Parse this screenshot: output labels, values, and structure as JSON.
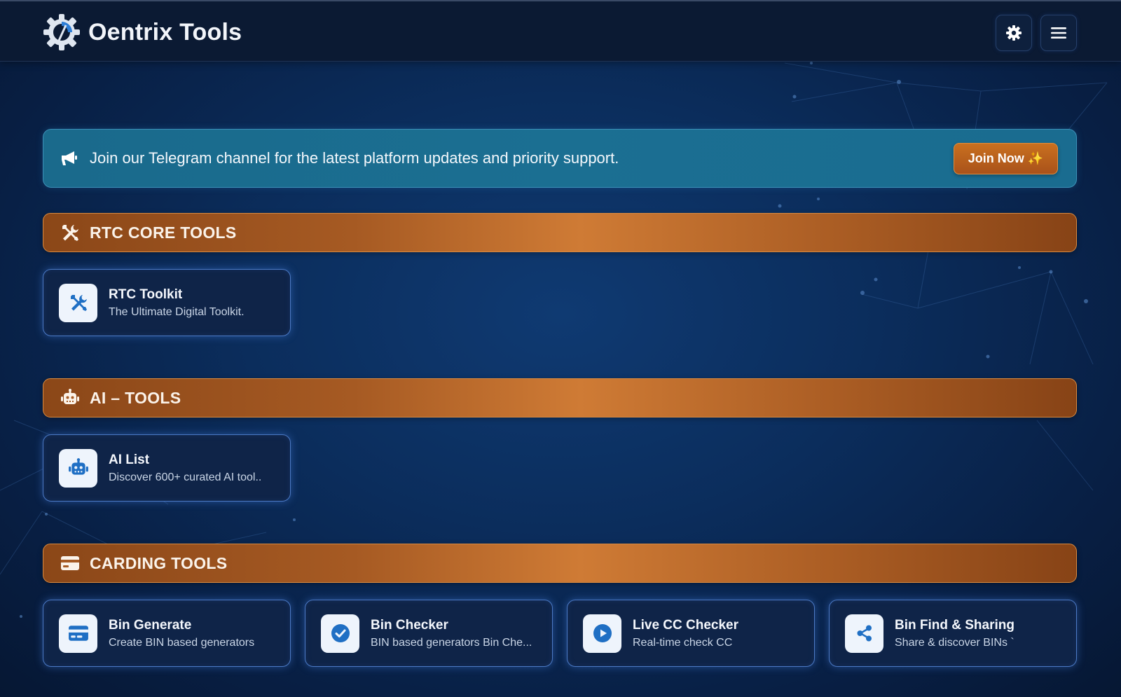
{
  "header": {
    "brand_name": "Oentrix Tools",
    "logo_icon": "gear-logo-icon",
    "settings_icon": "gear-icon",
    "menu_icon": "hamburger-menu-icon"
  },
  "banner": {
    "icon": "megaphone-icon",
    "text": "Join our Telegram channel for the latest platform updates and priority support.",
    "button_label": "Join Now ✨"
  },
  "sections": [
    {
      "title": "RTC CORE TOOLS",
      "icon": "tools-icon",
      "tools": [
        {
          "title": "RTC Toolkit",
          "desc": "The Ultimate Digital Toolkit.",
          "icon": "tools-icon"
        }
      ]
    },
    {
      "title": "AI – TOOLS",
      "icon": "robot-icon",
      "tools": [
        {
          "title": "AI List",
          "desc": "Discover 600+ curated AI tool..",
          "icon": "robot-icon"
        }
      ]
    },
    {
      "title": "CARDING TOOLS",
      "icon": "credit-card-icon",
      "tools": [
        {
          "title": "Bin Generate",
          "desc": "Create BIN based generators",
          "icon": "credit-card-icon"
        },
        {
          "title": "Bin Checker",
          "desc": "BIN based generators Bin Che...",
          "icon": "check-circle-icon"
        },
        {
          "title": "Live CC Checker",
          "desc": "Real-time check CC",
          "icon": "play-circle-icon"
        },
        {
          "title": "Bin Find & Sharing",
          "desc": "Share & discover BINs `",
          "icon": "share-icon"
        }
      ]
    }
  ],
  "colors": {
    "accent_orange": "#cf7b35",
    "banner_teal": "#1b6f92",
    "card_border": "#4b79c4",
    "icon_blue": "#1f6fc4"
  }
}
